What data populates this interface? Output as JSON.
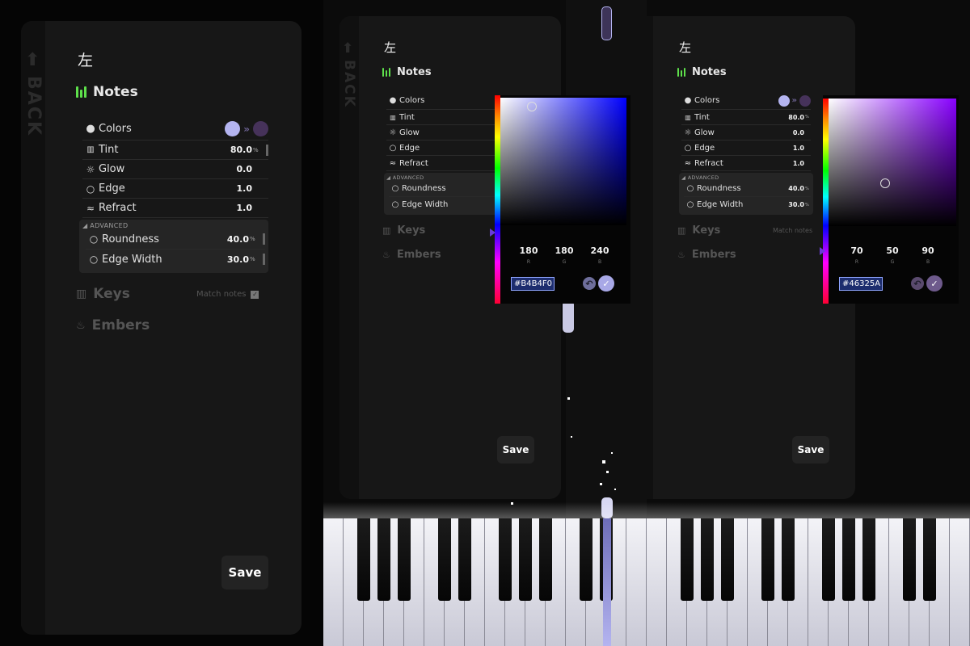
{
  "panel": {
    "back_label": "BACK",
    "title_char": "左",
    "notes_label": "Notes",
    "keys_label": "Keys",
    "embers_label": "Embers",
    "match_notes_label": "Match notes",
    "advanced_label": "ADVANCED",
    "save_label": "Save",
    "colors_row": {
      "label": "Colors",
      "icon": "palette-icon"
    },
    "rows": [
      {
        "label": "Tint",
        "icon": "tint-icon",
        "value": "80.0",
        "unit": "%"
      },
      {
        "label": "Glow",
        "icon": "glow-icon",
        "value": "0.0",
        "unit": ""
      },
      {
        "label": "Edge",
        "icon": "circle-icon",
        "value": "1.0",
        "unit": ""
      },
      {
        "label": "Refract",
        "icon": "refract-icon",
        "value": "1.0",
        "unit": ""
      }
    ],
    "advanced_rows": [
      {
        "label": "Roundness",
        "icon": "circle-icon",
        "value": "40.0",
        "unit": "%"
      },
      {
        "label": "Edge Width",
        "icon": "circle-icon",
        "value": "30.0",
        "unit": "%"
      }
    ],
    "colors": {
      "swatch_from": "#B4B4F0",
      "swatch_to": "#46325A",
      "accent_green": "#5EE04B"
    }
  },
  "picker1": {
    "r": "180",
    "g": "180",
    "b": "240",
    "r_label": "R",
    "g_label": "G",
    "b_label": "B",
    "hex": "#B4B4F0",
    "hue_color": "#0000FF"
  },
  "picker2": {
    "r": "70",
    "g": "50",
    "b": "90",
    "r_label": "R",
    "g_label": "G",
    "b_label": "B",
    "hex": "#46325A",
    "hue_color": "#8800FF"
  },
  "icons": {
    "undo": "undo-icon",
    "confirm": "check-icon",
    "back": "back-arrow-icon"
  }
}
